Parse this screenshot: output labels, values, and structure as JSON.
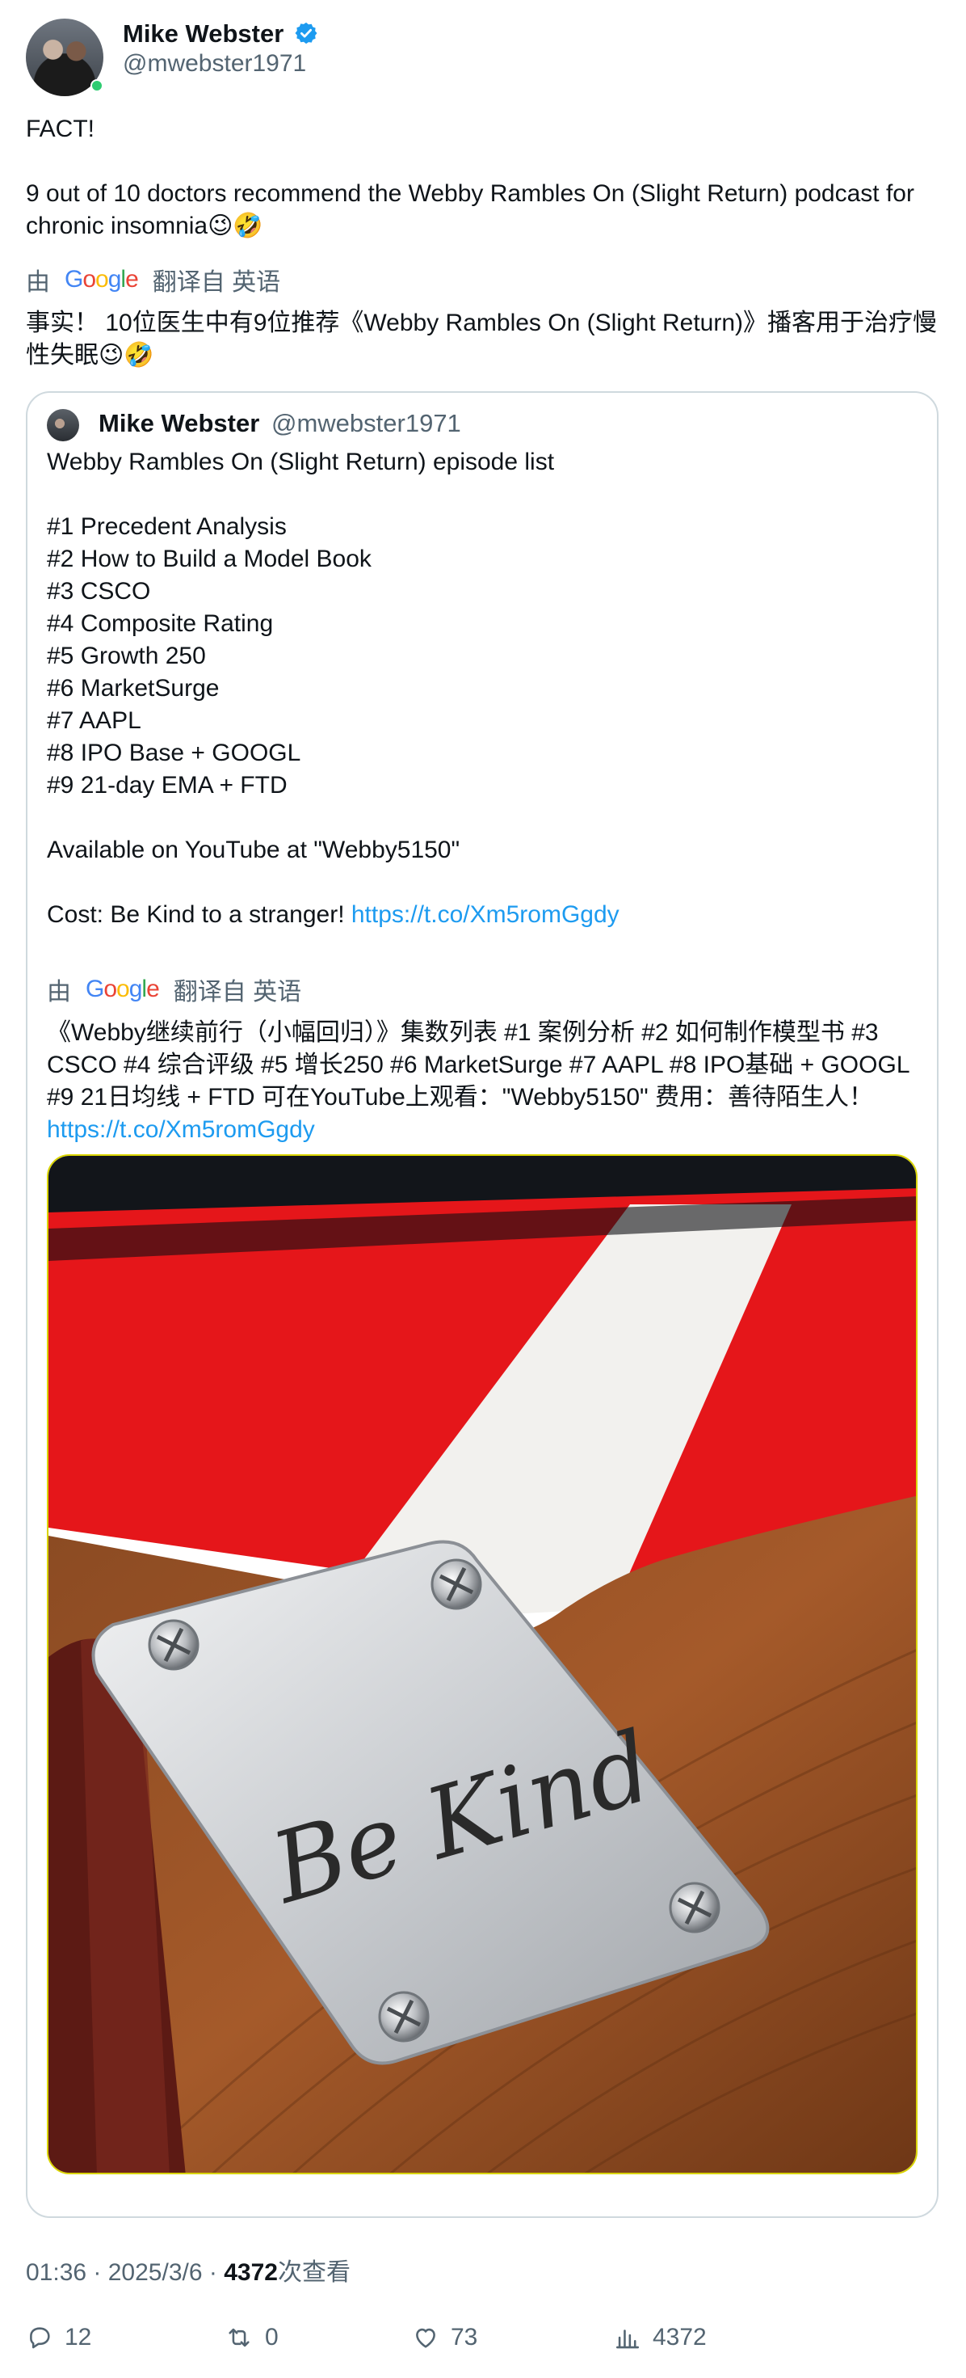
{
  "author": {
    "name": "Mike Webster",
    "handle": "@mwebster1971"
  },
  "tweet": {
    "text": "FACT!\n\n9 out of 10 doctors recommend the Webby Rambles On (Slight Return) podcast for chronic insomnia😉🤣",
    "translate_by": "由",
    "translate_brand": "Google",
    "translate_suffix": "翻译自 英语",
    "translation": "事实！ 10位医生中有9位推荐《Webby Rambles On (Slight Return)》播客用于治疗慢性失眠😉🤣"
  },
  "quote": {
    "name": "Mike Webster",
    "handle": "@mwebster1971",
    "text": "Webby Rambles On (Slight Return) episode list\n\n#1 Precedent Analysis\n#2 How to Build a Model Book\n#3 CSCO\n#4 Composite Rating\n#5 Growth 250\n#6 MarketSurge\n#7 AAPL\n#8 IPO Base + GOOGL\n#9 21-day EMA + FTD\n\nAvailable on YouTube at \"Webby5150\"\n\nCost: Be Kind to a stranger! ",
    "link": "https://t.co/Xm5romGgdy",
    "translate_by": "由",
    "translate_brand": "Google",
    "translate_suffix": "翻译自 英语",
    "translation": "《Webby继续前行（小幅回归）》集数列表 #1 案例分析 #2 如何制作模型书 #3 CSCO #4 综合评级 #5 增长250 #6 MarketSurge #7 AAPL #8 IPO基础 + GOOGL #9 21日均线 + FTD 可在YouTube上观看：\"Webby5150\" 费用：善待陌生人！",
    "translation_link": "https://t.co/Xm5romGgdy",
    "image_text": "Be Kind"
  },
  "meta": {
    "time": "01:36",
    "sep1": " · ",
    "date": "2025/3/6",
    "sep2": " · ",
    "views": "4372",
    "views_label": "次查看"
  },
  "actions": {
    "replies": "12",
    "retweets": "0",
    "likes": "73",
    "views": "4372"
  },
  "colors": {
    "link": "#1d9bf0",
    "secondary_text": "#536471",
    "verified": "#1d9bf0"
  }
}
